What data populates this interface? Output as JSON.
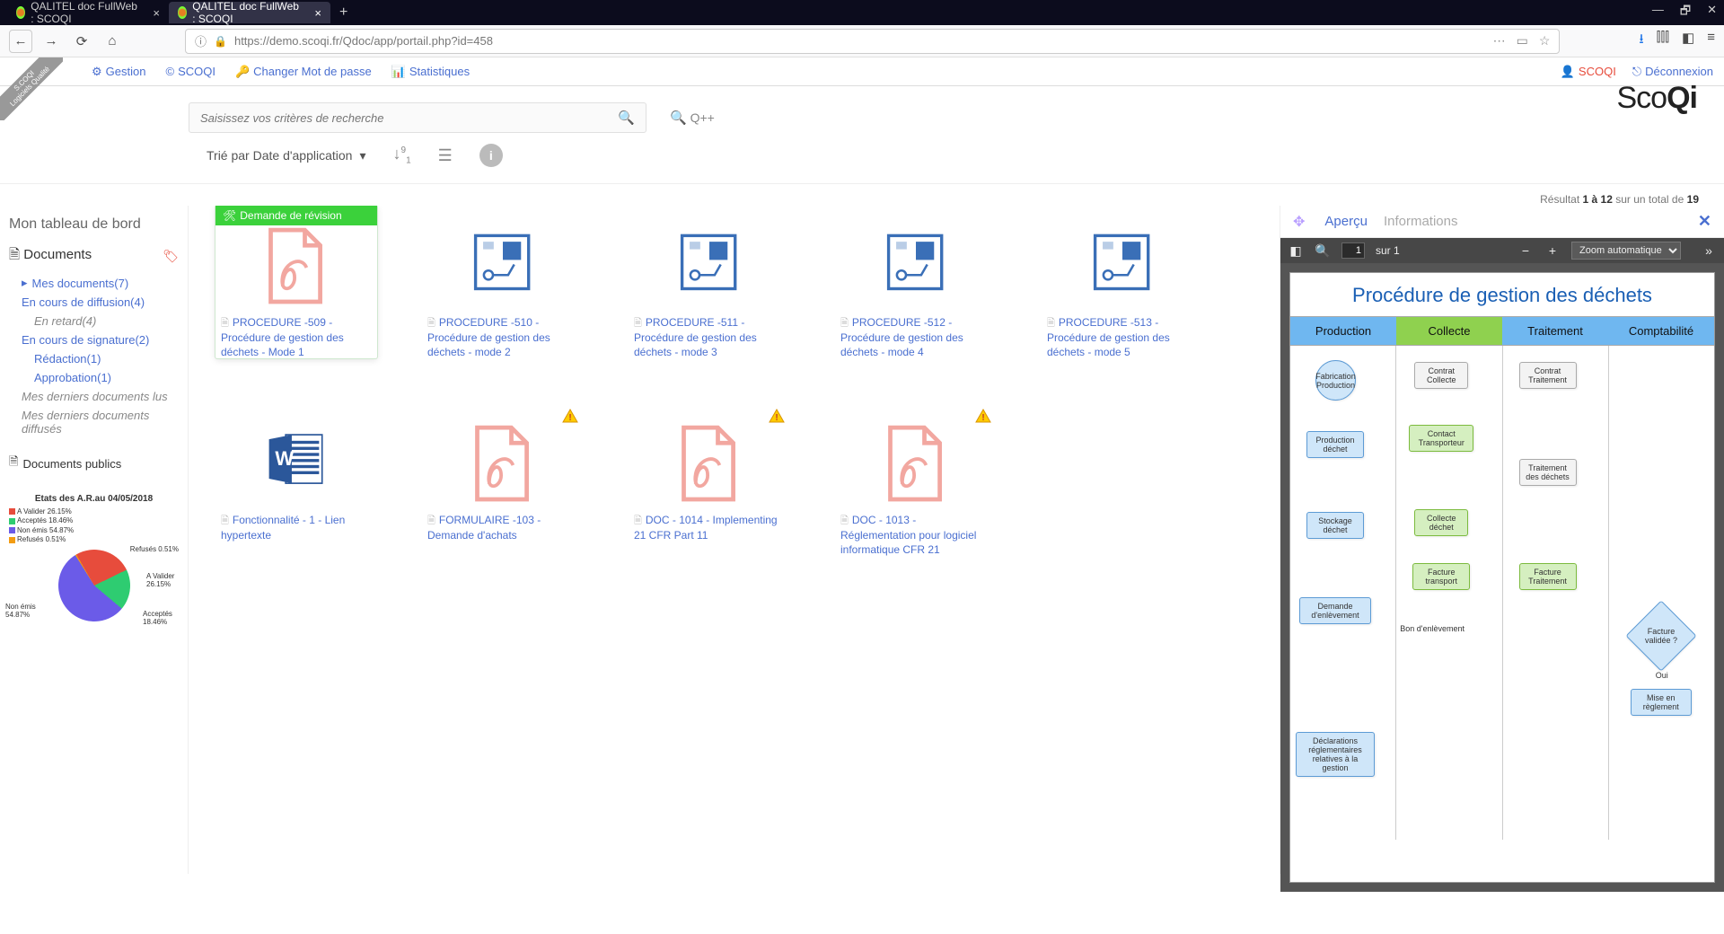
{
  "browser": {
    "tabs": [
      {
        "title": "QALITEL doc FullWeb : SCOQI"
      },
      {
        "title": "QALITEL doc FullWeb : SCOQI"
      }
    ],
    "url": "https://demo.scoqi.fr/Qdoc/app/portail.php?id=458"
  },
  "app_menu": {
    "gestion": "Gestion",
    "scoqi": "SCOQI",
    "changer_mdp": "Changer Mot de passe",
    "stats": "Statistiques",
    "user": "SCOQI",
    "logout": "Déconnexion"
  },
  "brand": "ScoQi",
  "search": {
    "placeholder": "Saisissez vos critères de recherche",
    "qpp": "Q++"
  },
  "sort": {
    "label": "Trié par Date d'application"
  },
  "results": {
    "prefix": "Résultat",
    "range": "1 à 12",
    "middle": "sur un total de",
    "total": "19"
  },
  "left_panel": {
    "title": "Mon tableau de bord",
    "root": "Documents",
    "tree": {
      "mes_docs": "Mes documents(7)",
      "en_diffusion": "En cours de diffusion(4)",
      "en_retard": "En retard(4)",
      "en_signature": "En cours de signature(2)",
      "redaction": "Rédaction(1)",
      "approbation": "Approbation(1)",
      "derniers_lus": "Mes derniers documents lus",
      "derniers_diffuses": "Mes derniers documents diffusés",
      "publics": "Documents publics"
    }
  },
  "chart_data": {
    "type": "pie",
    "title": "Etats des A.R.au 04/05/2018",
    "series": [
      {
        "name": "Refusés",
        "value": 0.51,
        "color": "#f39c12"
      },
      {
        "name": "Acceptés",
        "value": 18.46,
        "color": "#2ecc71"
      },
      {
        "name": "Non émis",
        "value": 54.87,
        "color": "#6b5be8"
      },
      {
        "name": "Refusés",
        "value": 0.51,
        "color": "#f39c12"
      },
      {
        "name": "A Valider",
        "value": 26.15,
        "color": "#e74c3c"
      }
    ],
    "labels": {
      "left_top": "A Valider 26.15%",
      "left2": "Acceptés 18.46%",
      "left3": "Non émis 54.87%",
      "left4": "Refusés 0.51%",
      "r_top": "Refusés 0.51%",
      "r_mid": "A Valider 26.15%",
      "l_bot": "Non émis 54.87%",
      "r_bot": "Acceptés 18.46%"
    }
  },
  "documents": [
    {
      "title": "PROCEDURE -509 - Procédure de gestion des déchets - Mode 1",
      "icon": "pdf",
      "selected": true,
      "badge": "Demande de révision"
    },
    {
      "title": "PROCEDURE -510 - Procédure de gestion des déchets - mode 2",
      "icon": "visio"
    },
    {
      "title": "PROCEDURE -511 - Procédure de gestion des déchets - mode 3",
      "icon": "visio"
    },
    {
      "title": "PROCEDURE -512 - Procédure de gestion des déchets - mode 4",
      "icon": "visio"
    },
    {
      "title": "PROCEDURE -513 - Procédure de gestion des déchets - mode 5",
      "icon": "visio"
    },
    {
      "title": "Fonctionnalité - 1 - Lien hypertexte",
      "icon": "word"
    },
    {
      "title": "FORMULAIRE -103 - Demande d'achats",
      "icon": "pdf",
      "alert": true
    },
    {
      "title": "DOC - 1014 - Implementing 21 CFR Part 11",
      "icon": "pdf",
      "alert": true
    },
    {
      "title": "DOC - 1013 - Réglementation pour logiciel informatique CFR 21",
      "icon": "pdf",
      "alert": true
    }
  ],
  "preview": {
    "tab_apercu": "Aperçu",
    "tab_info": "Informations",
    "pdf_bar": {
      "page": "1",
      "of": "sur 1",
      "zoom": "Zoom automatique"
    },
    "doc_title": "Procédure de gestion des déchets",
    "lanes": {
      "l1": "Production",
      "l2": "Collecte",
      "l3": "Traitement",
      "l4": "Comptabilité"
    },
    "nodes": {
      "fab": "Fabrication Production",
      "prod_dechet": "Production déchet",
      "stock": "Stockage déchet",
      "demande": "Demande d'enlèvement",
      "declarations": "Déclarations réglementaires relatives à la gestion",
      "contrat_collecte": "Contrat Collecte",
      "contact_transport": "Contact Transporteur",
      "collecte_dechet": "Collecte déchet",
      "facture_transport": "Facture transport",
      "contrat_trait": "Contrat Traitement",
      "trait_dechets": "Traitement des déchets",
      "facture_trait": "Facture Traitement",
      "facture_validee": "Facture validée ?",
      "oui": "Oui",
      "mise_reglement": "Mise en règlement",
      "bon": "Bon d'enlèvement"
    }
  },
  "ribbon": {
    "line1": "S.COQI",
    "line2": "Logiciels Qualité"
  }
}
